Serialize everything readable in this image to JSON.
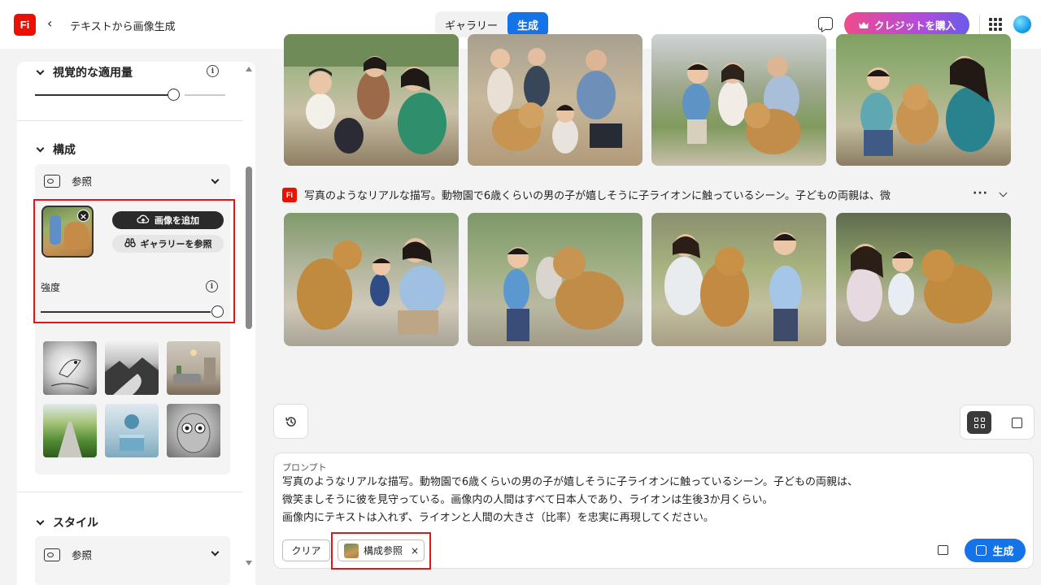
{
  "header": {
    "logo_text": "Fi",
    "back_icon": "‹",
    "title": "テキストから画像生成",
    "tabs": [
      {
        "label": "ギャラリー",
        "active": false
      },
      {
        "label": "生成",
        "active": true
      }
    ],
    "credit_button": "クレジットを購入"
  },
  "sidebar": {
    "visual_intensity": {
      "title": "視覚的な適用量",
      "value": 0.72
    },
    "composition": {
      "title": "構成",
      "reference_label": "参照",
      "add_image": "画像を追加",
      "browse_gallery": "ギャラリーを参照",
      "strength_label": "強度",
      "strength_value": 1.0
    },
    "style": {
      "title": "スタイル",
      "reference_label": "参照"
    }
  },
  "main": {
    "prompt_preview": "写真のようなリアルな描写。動物園で6歳くらいの男の子が嬉しそうに子ライオンに触っているシーン。子どもの両親は、微",
    "more": "···"
  },
  "prompt": {
    "label": "プロンプト",
    "lines": [
      "写真のようなリアルな描写。動物園で6歳くらいの男の子が嬉しそうに子ライオンに触っているシーン。子どもの両親は、",
      "微笑ましそうに彼を見守っている。画像内の人間はすべて日本人であり、ライオンは生後3か月くらい。",
      "画像内にテキストは入れず、ライオンと人間の大きさ（比率）を忠実に再現してください。"
    ],
    "clear": "クリア",
    "chip": "構成参照",
    "chip_close": "×",
    "generate": "生成"
  },
  "colors": {
    "accent": "#1473e6",
    "brand": "#eb1000",
    "highlight": "#e0161b"
  }
}
